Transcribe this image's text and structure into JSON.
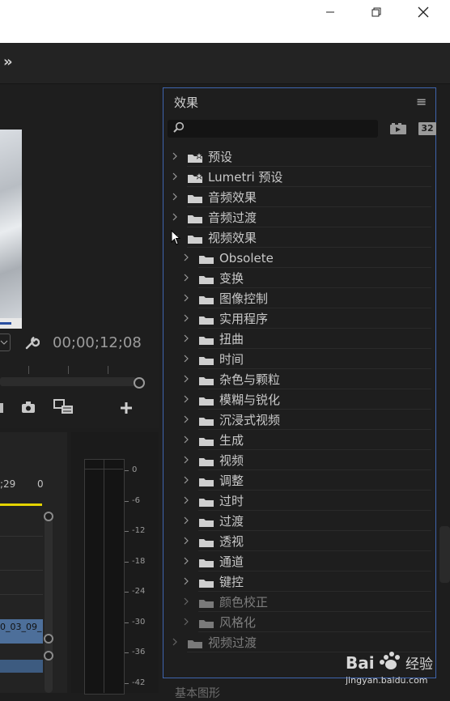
{
  "window": {
    "minimize_label": "minimize",
    "restore_label": "restore",
    "close_label": "close"
  },
  "toolbar": {
    "overflow_glyph": "»"
  },
  "program_monitor": {
    "timecode": "00;00;12;08"
  },
  "timeline": {
    "ruler_left": ";29",
    "ruler_right": "0",
    "clip_label": "0_03_09_"
  },
  "audio_meter": {
    "scale": [
      "0",
      "-6",
      "-12",
      "-18",
      "-24",
      "-30",
      "-36",
      "-42"
    ]
  },
  "effects_panel": {
    "title": "效果",
    "menu_glyph": "≡",
    "search": {
      "value": "",
      "placeholder": ""
    },
    "badge_32": "32",
    "items": [
      {
        "label": "预设",
        "level": 0,
        "icon": "star-folder-icon",
        "dim": false
      },
      {
        "label": "Lumetri 预设",
        "level": 0,
        "icon": "star-folder-icon",
        "dim": false
      },
      {
        "label": "音频效果",
        "level": 0,
        "icon": "folder-icon",
        "dim": false
      },
      {
        "label": "音频过渡",
        "level": 0,
        "icon": "folder-icon",
        "dim": false
      },
      {
        "label": "视频效果",
        "level": 0,
        "icon": "folder-icon",
        "dim": false,
        "expanded": true
      },
      {
        "label": "Obsolete",
        "level": 1,
        "icon": "folder-icon",
        "dim": false
      },
      {
        "label": "变换",
        "level": 1,
        "icon": "folder-icon",
        "dim": false
      },
      {
        "label": "图像控制",
        "level": 1,
        "icon": "folder-icon",
        "dim": false
      },
      {
        "label": "实用程序",
        "level": 1,
        "icon": "folder-icon",
        "dim": false
      },
      {
        "label": "扭曲",
        "level": 1,
        "icon": "folder-icon",
        "dim": false
      },
      {
        "label": "时间",
        "level": 1,
        "icon": "folder-icon",
        "dim": false
      },
      {
        "label": "杂色与颗粒",
        "level": 1,
        "icon": "folder-icon",
        "dim": false
      },
      {
        "label": "模糊与锐化",
        "level": 1,
        "icon": "folder-icon",
        "dim": false
      },
      {
        "label": "沉浸式视频",
        "level": 1,
        "icon": "folder-icon",
        "dim": false
      },
      {
        "label": "生成",
        "level": 1,
        "icon": "folder-icon",
        "dim": false
      },
      {
        "label": "视频",
        "level": 1,
        "icon": "folder-icon",
        "dim": false
      },
      {
        "label": "调整",
        "level": 1,
        "icon": "folder-icon",
        "dim": false
      },
      {
        "label": "过时",
        "level": 1,
        "icon": "folder-icon",
        "dim": false
      },
      {
        "label": "过渡",
        "level": 1,
        "icon": "folder-icon",
        "dim": false
      },
      {
        "label": "透视",
        "level": 1,
        "icon": "folder-icon",
        "dim": false
      },
      {
        "label": "通道",
        "level": 1,
        "icon": "folder-icon",
        "dim": false
      },
      {
        "label": "键控",
        "level": 1,
        "icon": "folder-icon",
        "dim": false
      },
      {
        "label": "颜色校正",
        "level": 1,
        "icon": "folder-icon",
        "dim": true
      },
      {
        "label": "风格化",
        "level": 1,
        "icon": "folder-icon",
        "dim": true
      },
      {
        "label": "视频过渡",
        "level": 0,
        "icon": "folder-icon",
        "dim": true
      }
    ]
  },
  "next_panel_label": "基本图形",
  "watermark": {
    "brand": "Bai",
    "brand2": "经验",
    "url": "jingyan.baidu.com"
  }
}
